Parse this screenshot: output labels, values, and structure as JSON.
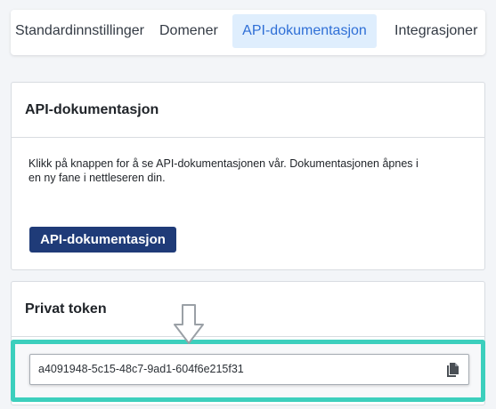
{
  "tabs": [
    {
      "label": "Standardinnstillinger",
      "active": false
    },
    {
      "label": "Domener",
      "active": false
    },
    {
      "label": "API-dokumentasjon",
      "active": true
    },
    {
      "label": "Integrasjoner",
      "active": false
    }
  ],
  "api_card": {
    "title": "API-dokumentasjon",
    "description": "Klikk på knappen for å se API-dokumentasjonen vår. Dokumentasjonen åpnes i en ny fane i nettleseren din.",
    "button_label": "API-dokumentasjon"
  },
  "token_card": {
    "title": "Privat token",
    "token_value": "a4091948-5c15-48c7-9ad1-604f6e215f31",
    "copy_icon": "copy-icon"
  },
  "annotation": {
    "arrow_icon": "down-arrow-icon",
    "highlight_color": "#3ccfbd"
  },
  "colors": {
    "active_tab_bg": "#dfeefd",
    "active_tab_text": "#2f6fd6",
    "primary_button": "#1f3b78"
  }
}
